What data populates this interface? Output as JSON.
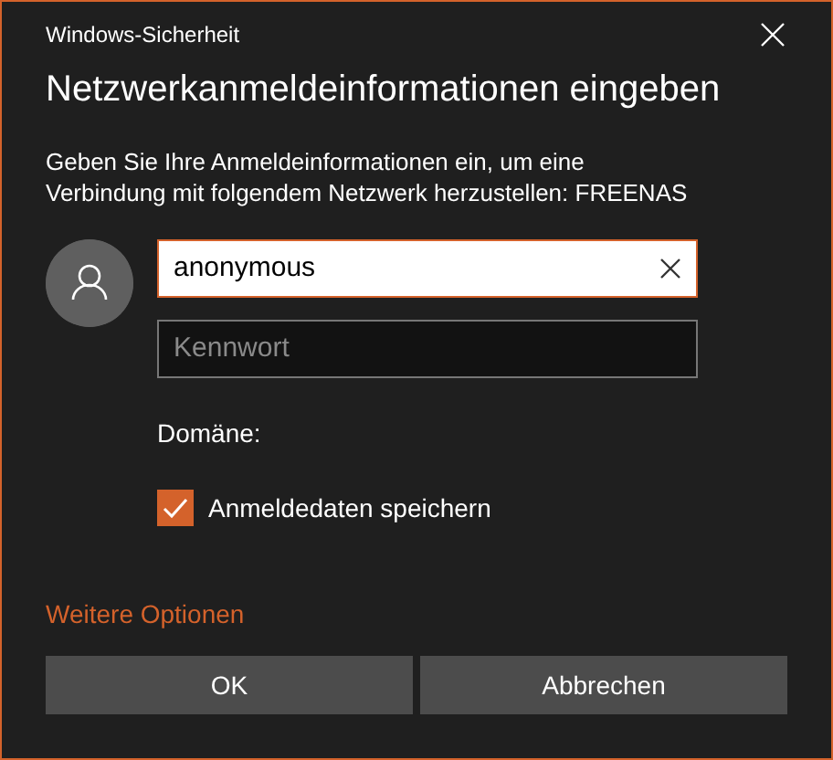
{
  "window": {
    "title": "Windows-Sicherheit"
  },
  "heading": "Netzwerkanmeldeinformationen eingeben",
  "message": "Geben Sie Ihre Anmeldeinformationen ein, um eine Verbindung mit folgendem Netzwerk herzustellen: FREENAS",
  "username": {
    "value": "anonymous",
    "focused": true
  },
  "password": {
    "placeholder": "Kennwort"
  },
  "domain_label": "Domäne:",
  "remember": {
    "label": "Anmeldedaten speichern",
    "checked": true
  },
  "more_options": "Weitere Optionen",
  "buttons": [
    "OK",
    "Abbrechen"
  ]
}
